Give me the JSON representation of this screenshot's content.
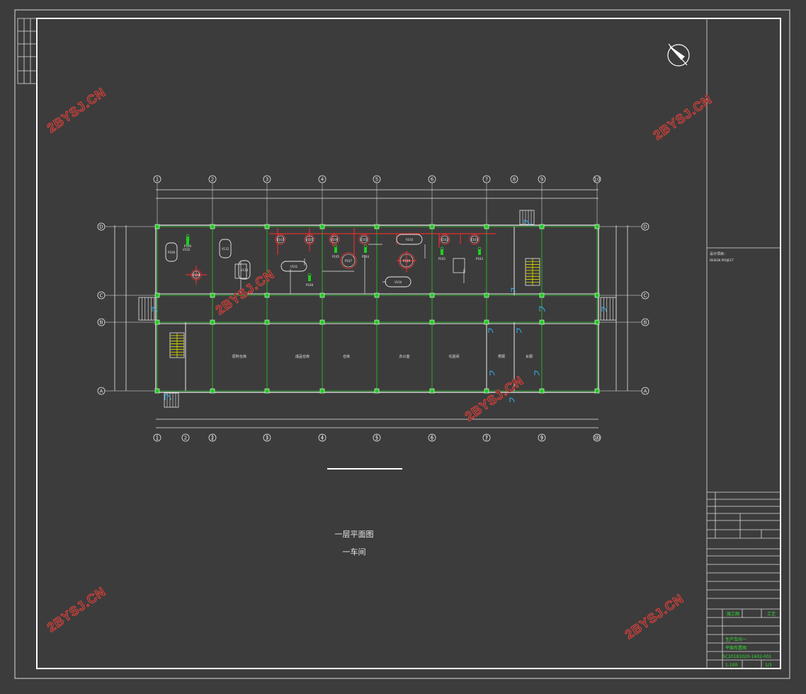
{
  "drawing": {
    "title": "一层平面图",
    "subtitle": "一车间",
    "axis_numbers": [
      "1",
      "2",
      "3",
      "4",
      "5",
      "6",
      "7",
      "8",
      "9",
      "10"
    ],
    "axis_letters": [
      "A",
      "B",
      "C",
      "D"
    ],
    "rooms": [
      "原料仓库",
      "成品仓库",
      "仓库",
      "办公室",
      "化验间",
      "男厕",
      "女厕"
    ],
    "equipment_labels": [
      "P106",
      "P108",
      "V112",
      "V113",
      "V101",
      "V103",
      "V104",
      "V107",
      "V105",
      "V106",
      "E101",
      "E102",
      "E103",
      "E104",
      "P107",
      "P109",
      "P105",
      "P104",
      "P102",
      "P103",
      "V102",
      "V108"
    ]
  },
  "title_block": {
    "project_label": "设计项目：",
    "project_sub": "DESIGN PROJECT",
    "stage": "施工图",
    "discipline": "工艺",
    "drawing_name_1": "生产车间一",
    "drawing_name_2": "平面布置图",
    "drawing_no": "SC20181020-1602-001",
    "scale": "1:100",
    "sheet": "1/3"
  },
  "watermark": "2BYSJ.CN",
  "colors": {
    "background": "#3c3c3c",
    "line": "#e8e8e8",
    "column": "#22cc22",
    "pipe": "#e03030",
    "stair": "#e0e000",
    "door": "#33bbff"
  }
}
